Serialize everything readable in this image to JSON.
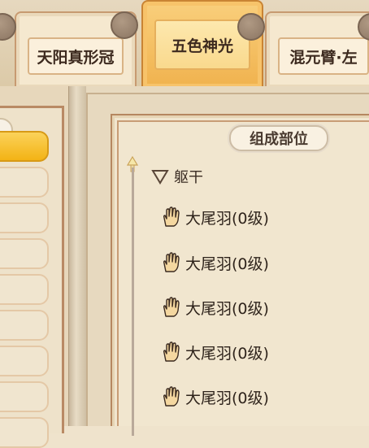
{
  "tabs": [
    {
      "label": "天阳真形冠",
      "active": false
    },
    {
      "label": "五色神光",
      "active": true
    },
    {
      "label": "混元臂·左",
      "active": false
    }
  ],
  "panel": {
    "section_title": "组成部位",
    "group": {
      "label": "躯干",
      "icon": "triangle-down-icon"
    },
    "items": [
      {
        "label": "大尾羽(0级)",
        "icon": "hand-icon"
      },
      {
        "label": "大尾羽(0级)",
        "icon": "hand-icon"
      },
      {
        "label": "大尾羽(0级)",
        "icon": "hand-icon"
      },
      {
        "label": "大尾羽(0级)",
        "icon": "hand-icon"
      },
      {
        "label": "大尾羽(0级)",
        "icon": "hand-icon"
      }
    ]
  },
  "colors": {
    "active_tab": "#f0b24e",
    "selected_list_item": "#f3b315",
    "panel_bg": "#f1e6cf"
  }
}
